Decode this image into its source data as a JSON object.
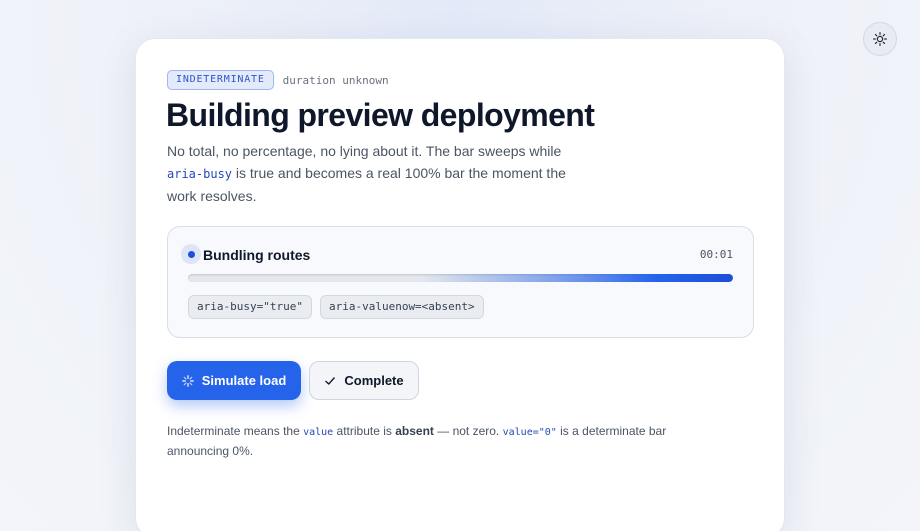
{
  "theme_toggle": {
    "icon": "sun-icon"
  },
  "header": {
    "badge": "INDETERMINATE",
    "duration": "duration unknown",
    "title": "Building preview deployment"
  },
  "description": {
    "part1": "No total, no percentage, no lying about it. The bar sweeps while ",
    "code": "aria-busy",
    "part2": " is true and becomes a real 100% bar the moment the work resolves."
  },
  "status_panel": {
    "step_label": "Bundling routes",
    "timer": "00:01",
    "progress": {
      "state": "indeterminate",
      "accent": "#2563eb"
    },
    "chips": [
      "aria-busy=\"true\"",
      "aria-valuenow=<absent>"
    ]
  },
  "actions": {
    "simulate": {
      "label": "Simulate load",
      "icon": "spinner-icon"
    },
    "complete": {
      "label": "Complete",
      "icon": "checkmark-icon"
    }
  },
  "footnote": {
    "t1": "Indeterminate means the ",
    "code1": "value",
    "t2": " attribute is ",
    "bold": "absent",
    "t3": " — not zero. ",
    "code2": "value=\"0\"",
    "t4": " is a determinate bar announcing 0%."
  },
  "colors": {
    "accent": "#2563eb",
    "badge_text": "#2f55c6",
    "badge_bg": "#e2eafc",
    "code": "#2449b8"
  }
}
